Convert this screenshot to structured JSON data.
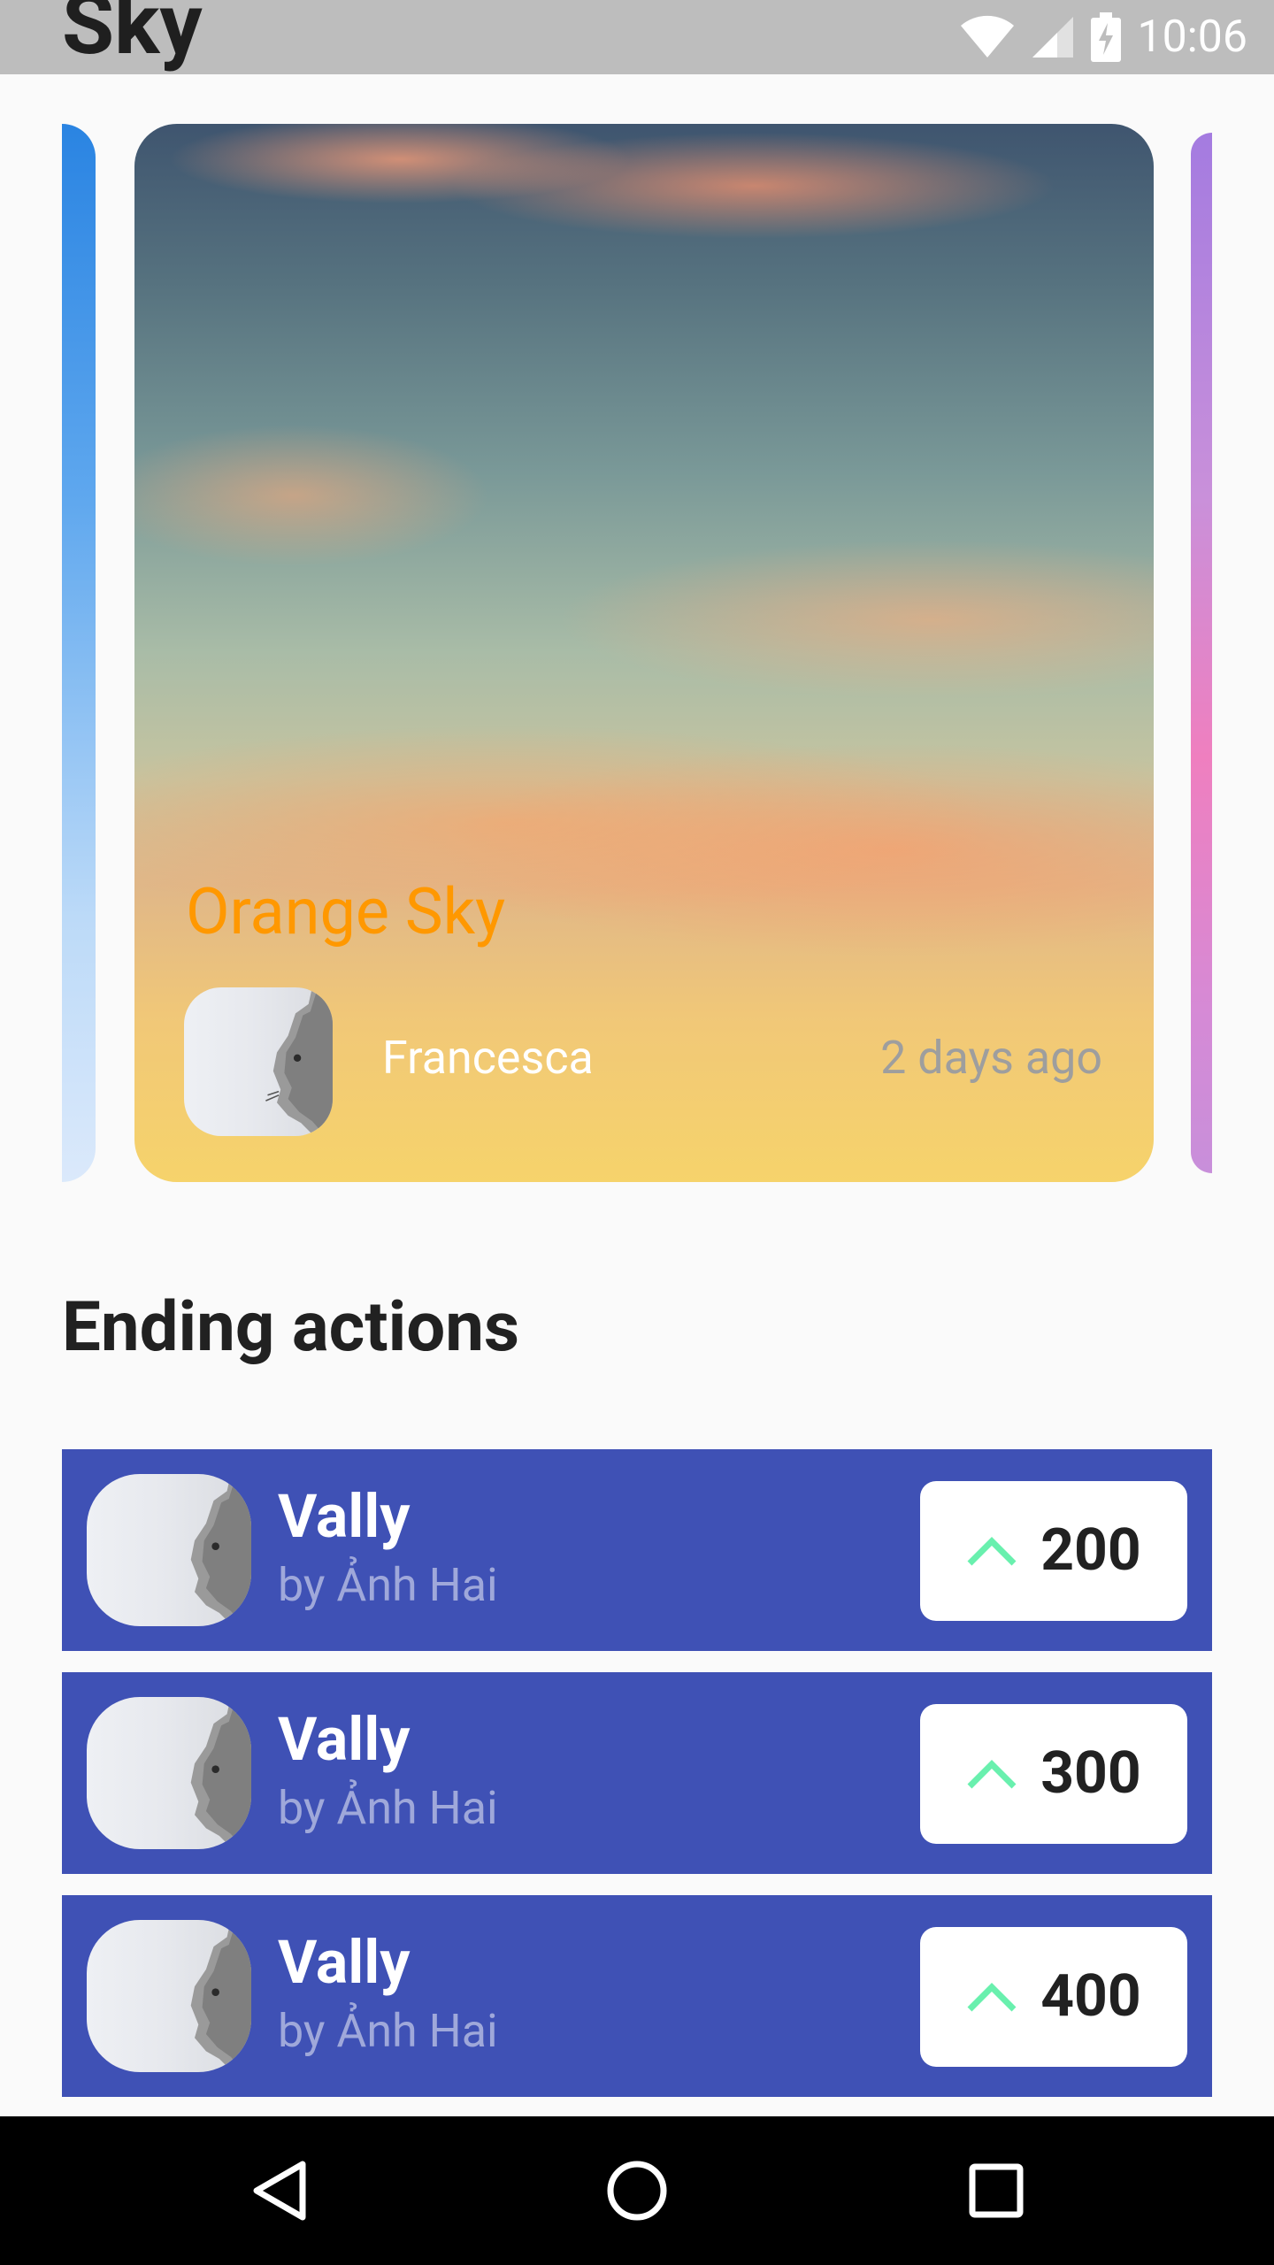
{
  "header": {
    "title": "Sky"
  },
  "status": {
    "time": "10:06"
  },
  "featured": {
    "title": "Orange Sky",
    "author": "Francesca",
    "time": "2 days ago"
  },
  "section": {
    "title": "Ending actions"
  },
  "items": [
    {
      "name": "Vally",
      "author": "by Ảnh Hai",
      "bid": "200"
    },
    {
      "name": "Vally",
      "author": "by Ảnh Hai",
      "bid": "300"
    },
    {
      "name": "Vally",
      "author": "by Ảnh Hai",
      "bid": "400"
    }
  ],
  "colors": {
    "accent": "#3f51b5",
    "title_orange": "#ff9800",
    "up_arrow": "#69f0ae"
  }
}
